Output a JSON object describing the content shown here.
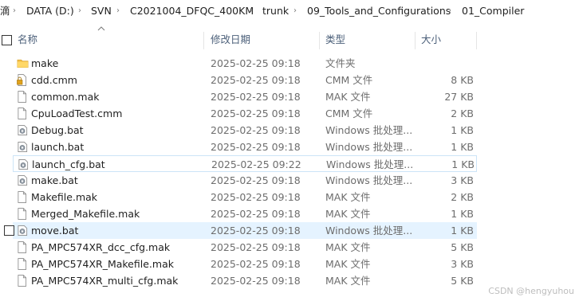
{
  "breadcrumb": {
    "cut_prefix": "滴",
    "items": [
      "DATA (D:)",
      "SVN",
      "C2021004_DFQC_400KM",
      "trunk",
      "09_Tools_and_Configurations",
      "01_Compiler"
    ]
  },
  "columns": {
    "name": "名称",
    "date": "修改日期",
    "type": "类型",
    "size": "大小"
  },
  "files": [
    {
      "name": "make",
      "date": "2025-02-25 09:18",
      "type": "文件夹",
      "size": "",
      "icon": "folder-icon"
    },
    {
      "name": "cdd.cmm",
      "date": "2025-02-25 09:18",
      "type": "CMM 文件",
      "size": "8 KB",
      "icon": "locked-file-icon"
    },
    {
      "name": "common.mak",
      "date": "2025-02-25 09:18",
      "type": "MAK 文件",
      "size": "27 KB",
      "icon": "file-icon"
    },
    {
      "name": "CpuLoadTest.cmm",
      "date": "2025-02-25 09:18",
      "type": "CMM 文件",
      "size": "2 KB",
      "icon": "file-icon"
    },
    {
      "name": "Debug.bat",
      "date": "2025-02-25 09:18",
      "type": "Windows 批处理...",
      "size": "1 KB",
      "icon": "batch-file-icon"
    },
    {
      "name": "launch.bat",
      "date": "2025-02-25 09:18",
      "type": "Windows 批处理...",
      "size": "1 KB",
      "icon": "batch-file-icon"
    },
    {
      "name": "launch_cfg.bat",
      "date": "2025-02-25 09:22",
      "type": "Windows 批处理...",
      "size": "1 KB",
      "icon": "batch-file-icon"
    },
    {
      "name": "make.bat",
      "date": "2025-02-25 09:18",
      "type": "Windows 批处理...",
      "size": "3 KB",
      "icon": "batch-file-icon"
    },
    {
      "name": "Makefile.mak",
      "date": "2025-02-25 09:18",
      "type": "MAK 文件",
      "size": "2 KB",
      "icon": "file-icon"
    },
    {
      "name": "Merged_Makefile.mak",
      "date": "2025-02-25 09:18",
      "type": "MAK 文件",
      "size": "1 KB",
      "icon": "file-icon"
    },
    {
      "name": "move.bat",
      "date": "2025-02-25 09:18",
      "type": "Windows 批处理...",
      "size": "1 KB",
      "icon": "batch-file-icon"
    },
    {
      "name": "PA_MPC574XR_dcc_cfg.mak",
      "date": "2025-02-25 09:18",
      "type": "MAK 文件",
      "size": "5 KB",
      "icon": "file-icon"
    },
    {
      "name": "PA_MPC574XR_Makefile.mak",
      "date": "2025-02-25 09:18",
      "type": "MAK 文件",
      "size": "3 KB",
      "icon": "file-icon"
    },
    {
      "name": "PA_MPC574XR_multi_cfg.mak",
      "date": "2025-02-25 09:18",
      "type": "MAK 文件",
      "size": "5 KB",
      "icon": "file-icon"
    }
  ],
  "outlined_row_index": 6,
  "hovered_row_index": 10,
  "watermark": "CSDN @hengyuhou",
  "colors": {
    "header_text": "#4c607a",
    "hover_bg": "#e5f3ff",
    "outline": "#cce4f7"
  }
}
